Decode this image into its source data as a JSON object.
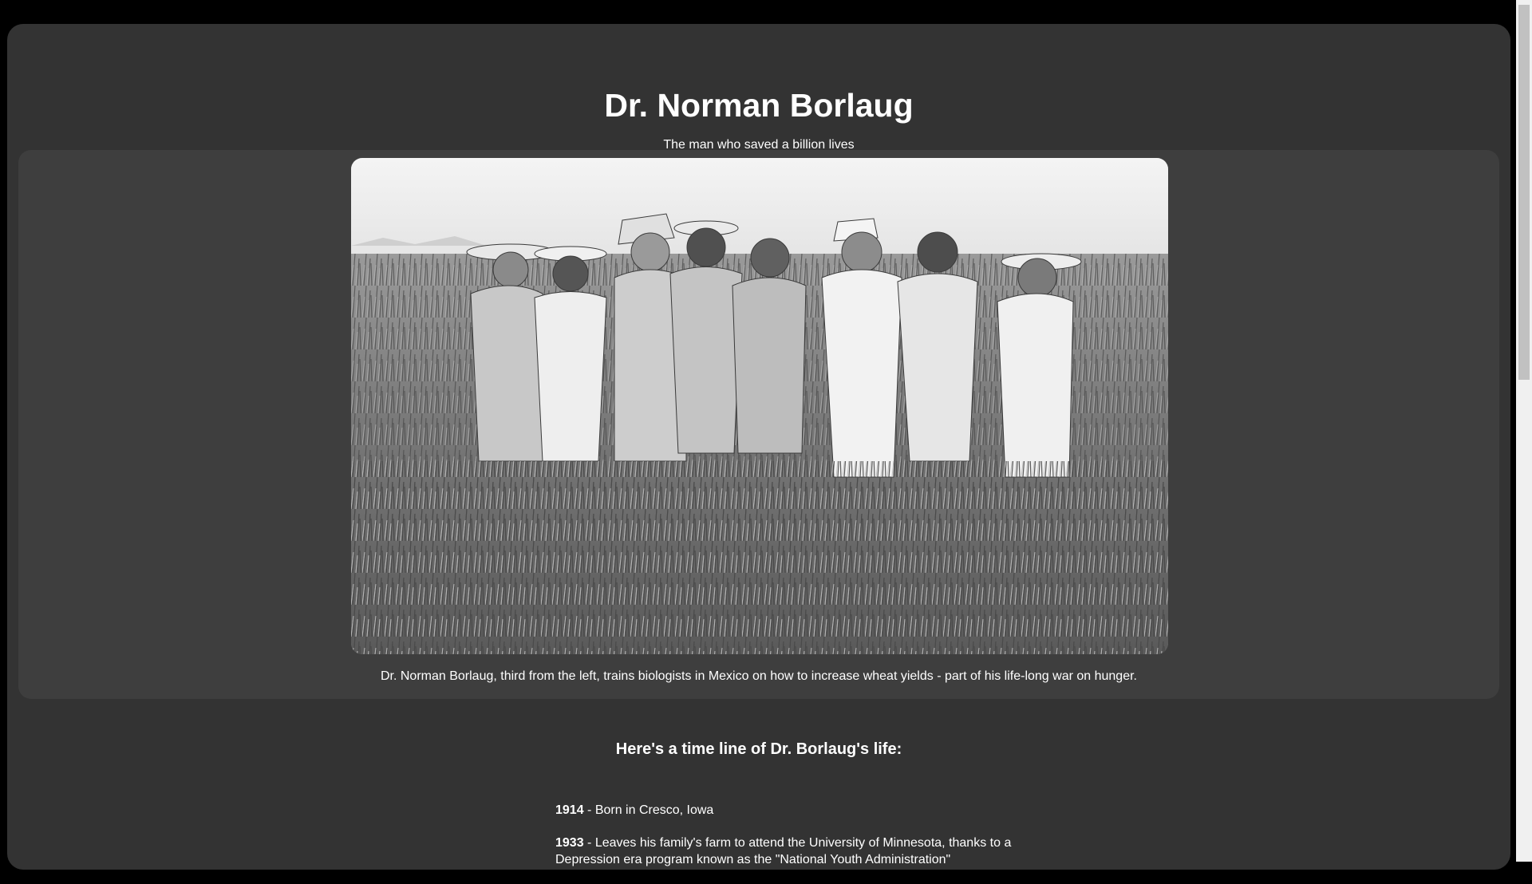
{
  "header": {
    "title": "Dr. Norman Borlaug",
    "subtitle": "The man who saved a billion lives"
  },
  "figure": {
    "image_alt": "Black-and-white photo of Norman Borlaug and biologists standing in a wheat field",
    "caption": "Dr. Norman Borlaug, third from the left, trains biologists in Mexico on how to increase wheat yields - part of his life-long war on hunger."
  },
  "timeline": {
    "heading": "Here's a time line of Dr. Borlaug's life:",
    "items": [
      {
        "year": "1914",
        "text": " - Born in Cresco, Iowa"
      },
      {
        "year": "1933",
        "text": " - Leaves his family's farm to attend the University of Minnesota, thanks to a Depression era program known as the \"National Youth Administration\""
      }
    ]
  }
}
